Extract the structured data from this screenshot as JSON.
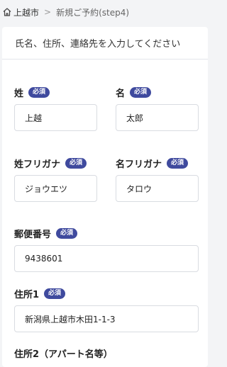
{
  "breadcrumb": {
    "home_icon": "home-icon",
    "home_label": "上越市",
    "separator": ">",
    "current": "新規ご予約(step4)"
  },
  "form": {
    "header": "氏名、住所、連絡先を入力してください",
    "required_badge": "必須",
    "last_name": {
      "label": "姓",
      "value": "上越"
    },
    "first_name": {
      "label": "名",
      "value": "太郎"
    },
    "last_name_kana": {
      "label": "姓フリガナ",
      "value": "ジョウエツ"
    },
    "first_name_kana": {
      "label": "名フリガナ",
      "value": "タロウ"
    },
    "postal_code": {
      "label": "郵便番号",
      "value": "9438601"
    },
    "address1": {
      "label": "住所1",
      "value": "新潟県上越市木田1-1-3"
    },
    "address2": {
      "label": "住所2（アパート名等）"
    }
  },
  "colors": {
    "badge": "#3f4a9e",
    "page_bg": "#f3f4f6"
  }
}
